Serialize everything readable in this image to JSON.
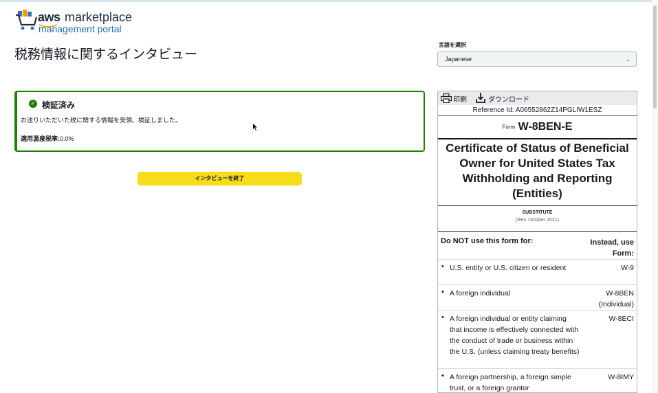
{
  "header": {
    "logo_aws": "aws",
    "logo_marketplace": "marketplace",
    "logo_portal": "management portal"
  },
  "page": {
    "title": "税務情報に関するインタビュー"
  },
  "language": {
    "label": "言語を選択",
    "selected": "Japanese"
  },
  "verification": {
    "title": "検証済み",
    "message": "お送りいただいた税に関する情報を受領、検証しました。",
    "rate_label": "適用源泉税率:",
    "rate_value": "0.0%"
  },
  "actions": {
    "end_interview": "インタビューを終了"
  },
  "form_preview": {
    "toolbar": {
      "print": "印刷",
      "download": "ダウンロード"
    },
    "reference": "Reference Id: A06552862Z14PGLIW1ESZ",
    "form_prefix": "Form",
    "form_name": "W-8BEN-E",
    "title": "Certificate of Status of Beneficial Owner for United States Tax Withholding and Reporting (Entities)",
    "substitute": "SUBSTITUTE",
    "revision": "(Rev. October 2021)",
    "table_header_left": "Do NOT use this form for:",
    "table_header_right": "Instead, use Form:",
    "rows": [
      {
        "desc": "U.S. entity or U.S. citizen or resident",
        "form": "W-9"
      },
      {
        "desc": "A foreign individual",
        "form": "W-8BEN (Individual)"
      },
      {
        "desc": "A foreign individual or entity claiming that income is effectively connected with the conduct of trade or business within the U.S. (unless claiming treaty benefits)",
        "form": "W-8ECI"
      },
      {
        "desc": "A foreign partnership, a foreign simple trust, or a foreign grantor",
        "form": "W-8IMY"
      }
    ]
  },
  "colors": {
    "success": "#1d8102",
    "button": "#f7dc1a",
    "logo_orange": "#f90"
  }
}
